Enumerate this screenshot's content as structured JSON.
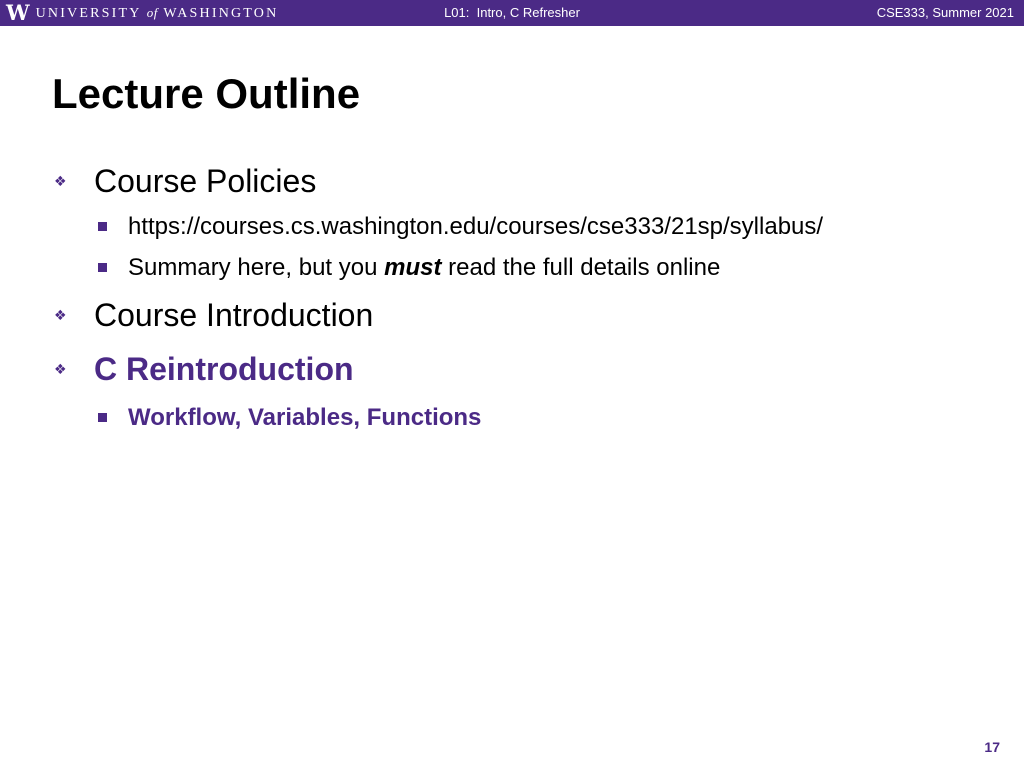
{
  "header": {
    "logo_letter": "W",
    "logo_university": "UNIVERSITY",
    "logo_of": "of",
    "logo_washington": "WASHINGTON",
    "lecture": "L01:  Intro, C Refresher",
    "course": "CSE333, Summer 2021"
  },
  "slide": {
    "title": "Lecture Outline",
    "items": [
      {
        "text": "Course Policies"
      },
      {
        "text": "https://courses.cs.washington.edu/courses/cse333/21sp/syllabus/"
      },
      {
        "prefix": "Summary here, but you ",
        "emphasis": "must",
        "suffix": " read the full details online"
      },
      {
        "text": "Course Introduction"
      },
      {
        "text": "C Reintroduction"
      },
      {
        "text": "Workflow, Variables, Functions"
      }
    ],
    "page_number": "17"
  },
  "colors": {
    "accent": "#4b2a86",
    "text": "#000000",
    "background": "#ffffff"
  },
  "icons": {
    "level1_bullet": "diamond-bullet-icon",
    "level2_bullet": "square-bullet-icon"
  }
}
